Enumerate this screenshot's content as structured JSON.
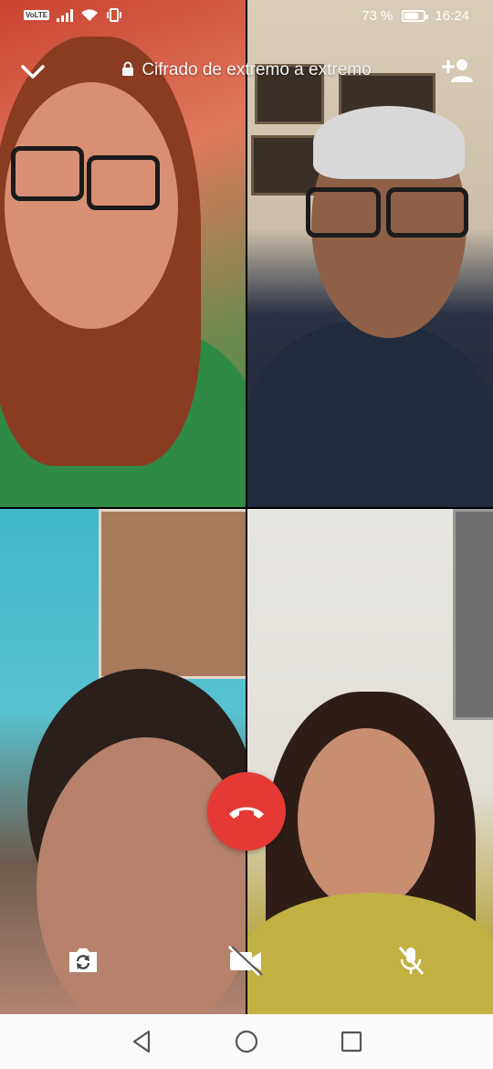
{
  "status_bar": {
    "volte_label": "VoLTE",
    "battery_percent_label": "73 %",
    "battery_level": 0.73,
    "time": "16:24"
  },
  "call": {
    "encryption_label": "Cifrado de extremo a extremo",
    "participants_count": 4
  },
  "icons": {
    "minimize": "chevron-down-icon",
    "lock": "lock-icon",
    "add_participant": "add-person-icon",
    "end_call": "phone-hangup-icon",
    "switch_camera": "camera-switch-icon",
    "video_off": "video-off-icon",
    "mic_off": "mic-off-icon",
    "nav_back": "triangle-back-icon",
    "nav_home": "circle-home-icon",
    "nav_recents": "square-recents-icon"
  },
  "colors": {
    "end_call": "#e53935",
    "nav_bar_bg": "#fafafa",
    "icon": "#ffffff"
  }
}
